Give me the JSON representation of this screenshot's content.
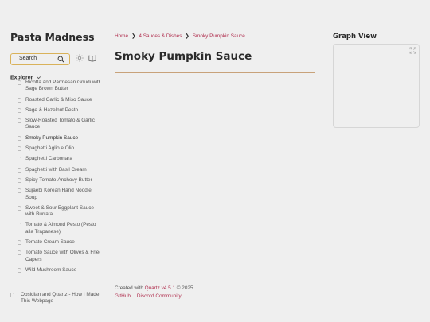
{
  "sidebar": {
    "site_title": "Pasta Madness",
    "search_label": "Search",
    "explorer_label": "Explorer",
    "files": [
      {
        "label": "Ricotta and Parmesan Gnudi with Sage Brown Butter",
        "active": false
      },
      {
        "label": "Roasted Garlic & Miso Sauce",
        "active": false
      },
      {
        "label": "Sage & Hazelnut Pesto",
        "active": false
      },
      {
        "label": "Slow-Roasted Tomato & Garlic Sauce",
        "active": false
      },
      {
        "label": "Smoky Pumpkin Sauce",
        "active": true
      },
      {
        "label": "Spaghetti Aglio e Olio",
        "active": false
      },
      {
        "label": "Spaghetti Carbonara",
        "active": false
      },
      {
        "label": "Spaghetti with Basil Cream",
        "active": false
      },
      {
        "label": "Spicy Tomato-Anchovy Butter",
        "active": false
      },
      {
        "label": "Sujaebi Korean Hand Noodle Soup",
        "active": false
      },
      {
        "label": "Sweet & Sour Eggplant Sauce with Burrata",
        "active": false
      },
      {
        "label": "Tomato & Almond Pesto (Pesto alla Trapanese)",
        "active": false
      },
      {
        "label": "Tomato Cream Sauce",
        "active": false
      },
      {
        "label": "Tomato Sauce with Olives & Fried Capers",
        "active": false
      },
      {
        "label": "Wild Mushroom Sauce",
        "active": false
      }
    ],
    "root_file": "Obsidian and Quartz - How I Made This Webpage"
  },
  "breadcrumb": {
    "home": "Home",
    "folder": "4 Sauces & Dishes",
    "current": "Smoky Pumpkin Sauce",
    "separator": "❯"
  },
  "page_title": "Smoky Pumpkin Sauce",
  "footer": {
    "created_prefix": "Created with ",
    "quartz_link": "Quartz v4.5.1",
    "copyright": " © 2025",
    "github": "GitHub",
    "discord": "Discord Community"
  },
  "graph": {
    "title": "Graph View"
  },
  "colors": {
    "accent": "#b02e4e",
    "search_border": "#d9b25a",
    "rule": "#c8a27a",
    "background": "#efefef"
  },
  "icons": [
    "search-icon",
    "sun-icon",
    "book-icon",
    "chevron-down-icon",
    "file-icon",
    "expand-icon"
  ]
}
